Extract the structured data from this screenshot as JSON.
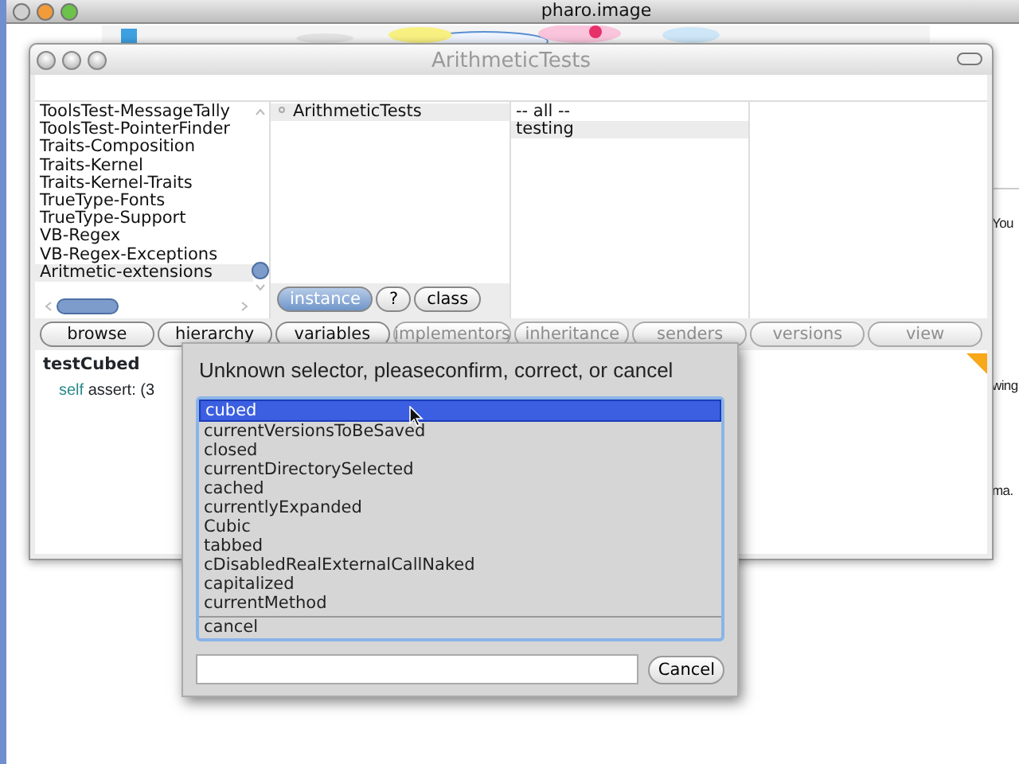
{
  "host_window": {
    "title": "pharo.image"
  },
  "background_window": {
    "texts": [
      "You",
      "wing",
      "ma."
    ]
  },
  "browser": {
    "title": "ArithmeticTests",
    "packages": [
      {
        "label": "ToolsTest-MessageTally",
        "selected": false
      },
      {
        "label": "ToolsTest-PointerFinder",
        "selected": false
      },
      {
        "label": "Traits-Composition",
        "selected": false
      },
      {
        "label": "Traits-Kernel",
        "selected": false
      },
      {
        "label": "Traits-Kernel-Traits",
        "selected": false
      },
      {
        "label": "TrueType-Fonts",
        "selected": false
      },
      {
        "label": "TrueType-Support",
        "selected": false
      },
      {
        "label": "VB-Regex",
        "selected": false
      },
      {
        "label": "VB-Regex-Exceptions",
        "selected": false
      },
      {
        "label": "Aritmetic-extensions",
        "selected": true
      }
    ],
    "classes": [
      {
        "label": "ArithmeticTests",
        "selected": true
      }
    ],
    "categories": [
      {
        "label": "-- all --",
        "selected": false
      },
      {
        "label": "testing",
        "selected": true
      }
    ],
    "side_buttons": [
      {
        "label": "instance",
        "selected": true
      },
      {
        "label": "?",
        "selected": false
      },
      {
        "label": "class",
        "selected": false
      }
    ],
    "toolbar": [
      {
        "label": "browse",
        "disabled": false
      },
      {
        "label": "hierarchy",
        "disabled": false
      },
      {
        "label": "variables",
        "disabled": false
      },
      {
        "label": "implementors",
        "disabled": true
      },
      {
        "label": "inheritance",
        "disabled": true
      },
      {
        "label": "senders",
        "disabled": true
      },
      {
        "label": "versions",
        "disabled": true
      },
      {
        "label": "view",
        "disabled": true
      }
    ],
    "code": {
      "method": "testCubed",
      "line": [
        {
          "text": "self",
          "kind": "keyword"
        },
        {
          "text": "assert: (3",
          "kind": "plain"
        }
      ]
    }
  },
  "dialog": {
    "title": "Unknown selector, pleaseconfirm, correct, or cancel",
    "options": [
      {
        "label": "cubed",
        "selected": true
      },
      {
        "label": "currentVersionsToBeSaved",
        "selected": false
      },
      {
        "label": "closed",
        "selected": false
      },
      {
        "label": "currentDirectorySelected",
        "selected": false
      },
      {
        "label": "cached",
        "selected": false
      },
      {
        "label": "currentlyExpanded",
        "selected": false
      },
      {
        "label": "Cubic",
        "selected": false
      },
      {
        "label": "tabbed",
        "selected": false
      },
      {
        "label": "cDisabledRealExternalCallNaked",
        "selected": false
      },
      {
        "label": "capitalized",
        "selected": false
      },
      {
        "label": "currentMethod",
        "selected": false
      }
    ],
    "cancel_option": "cancel",
    "cancel_button": "Cancel"
  }
}
